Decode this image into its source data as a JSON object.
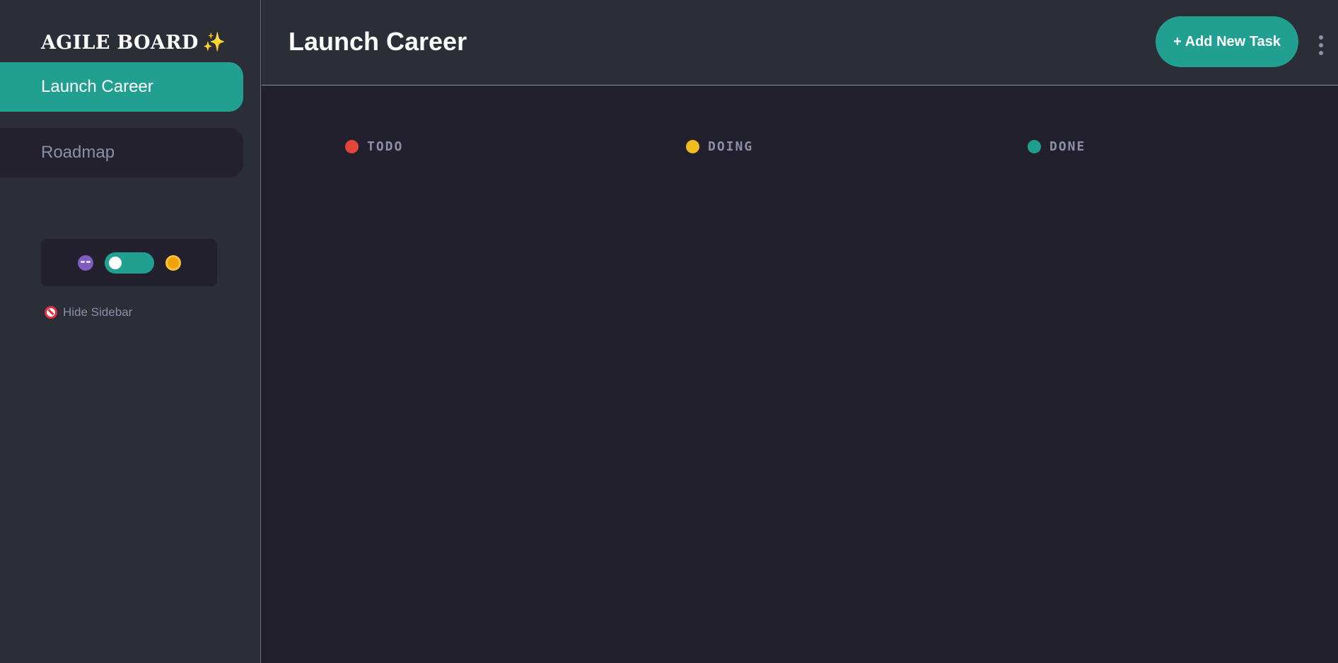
{
  "app": {
    "brand": "AGILE BOARD",
    "brand_icon": "sparkles-icon"
  },
  "sidebar": {
    "boards": [
      {
        "label": "Launch Career",
        "active": true
      },
      {
        "label": "Roadmap",
        "active": false
      }
    ],
    "theme_toggle": {
      "dark_icon": "dark-mode-face-icon",
      "light_icon": "sun-icon",
      "dark_mode": true
    },
    "hide_sidebar_label": "Hide Sidebar",
    "hide_sidebar_icon": "no-entry-icon"
  },
  "header": {
    "title": "Launch Career",
    "add_task_label": "+ Add New Task",
    "menu_icon": "vertical-ellipsis-icon"
  },
  "columns": [
    {
      "name": "TODO",
      "color": "#e0473a"
    },
    {
      "name": "DOING",
      "color": "#efbc1f"
    },
    {
      "name": "DONE",
      "color": "#1f9e90"
    }
  ],
  "colors": {
    "accent": "#21a092",
    "sidebar_bg": "#2b2d37",
    "main_bg": "#21202c",
    "muted_text": "#8b90a6"
  }
}
